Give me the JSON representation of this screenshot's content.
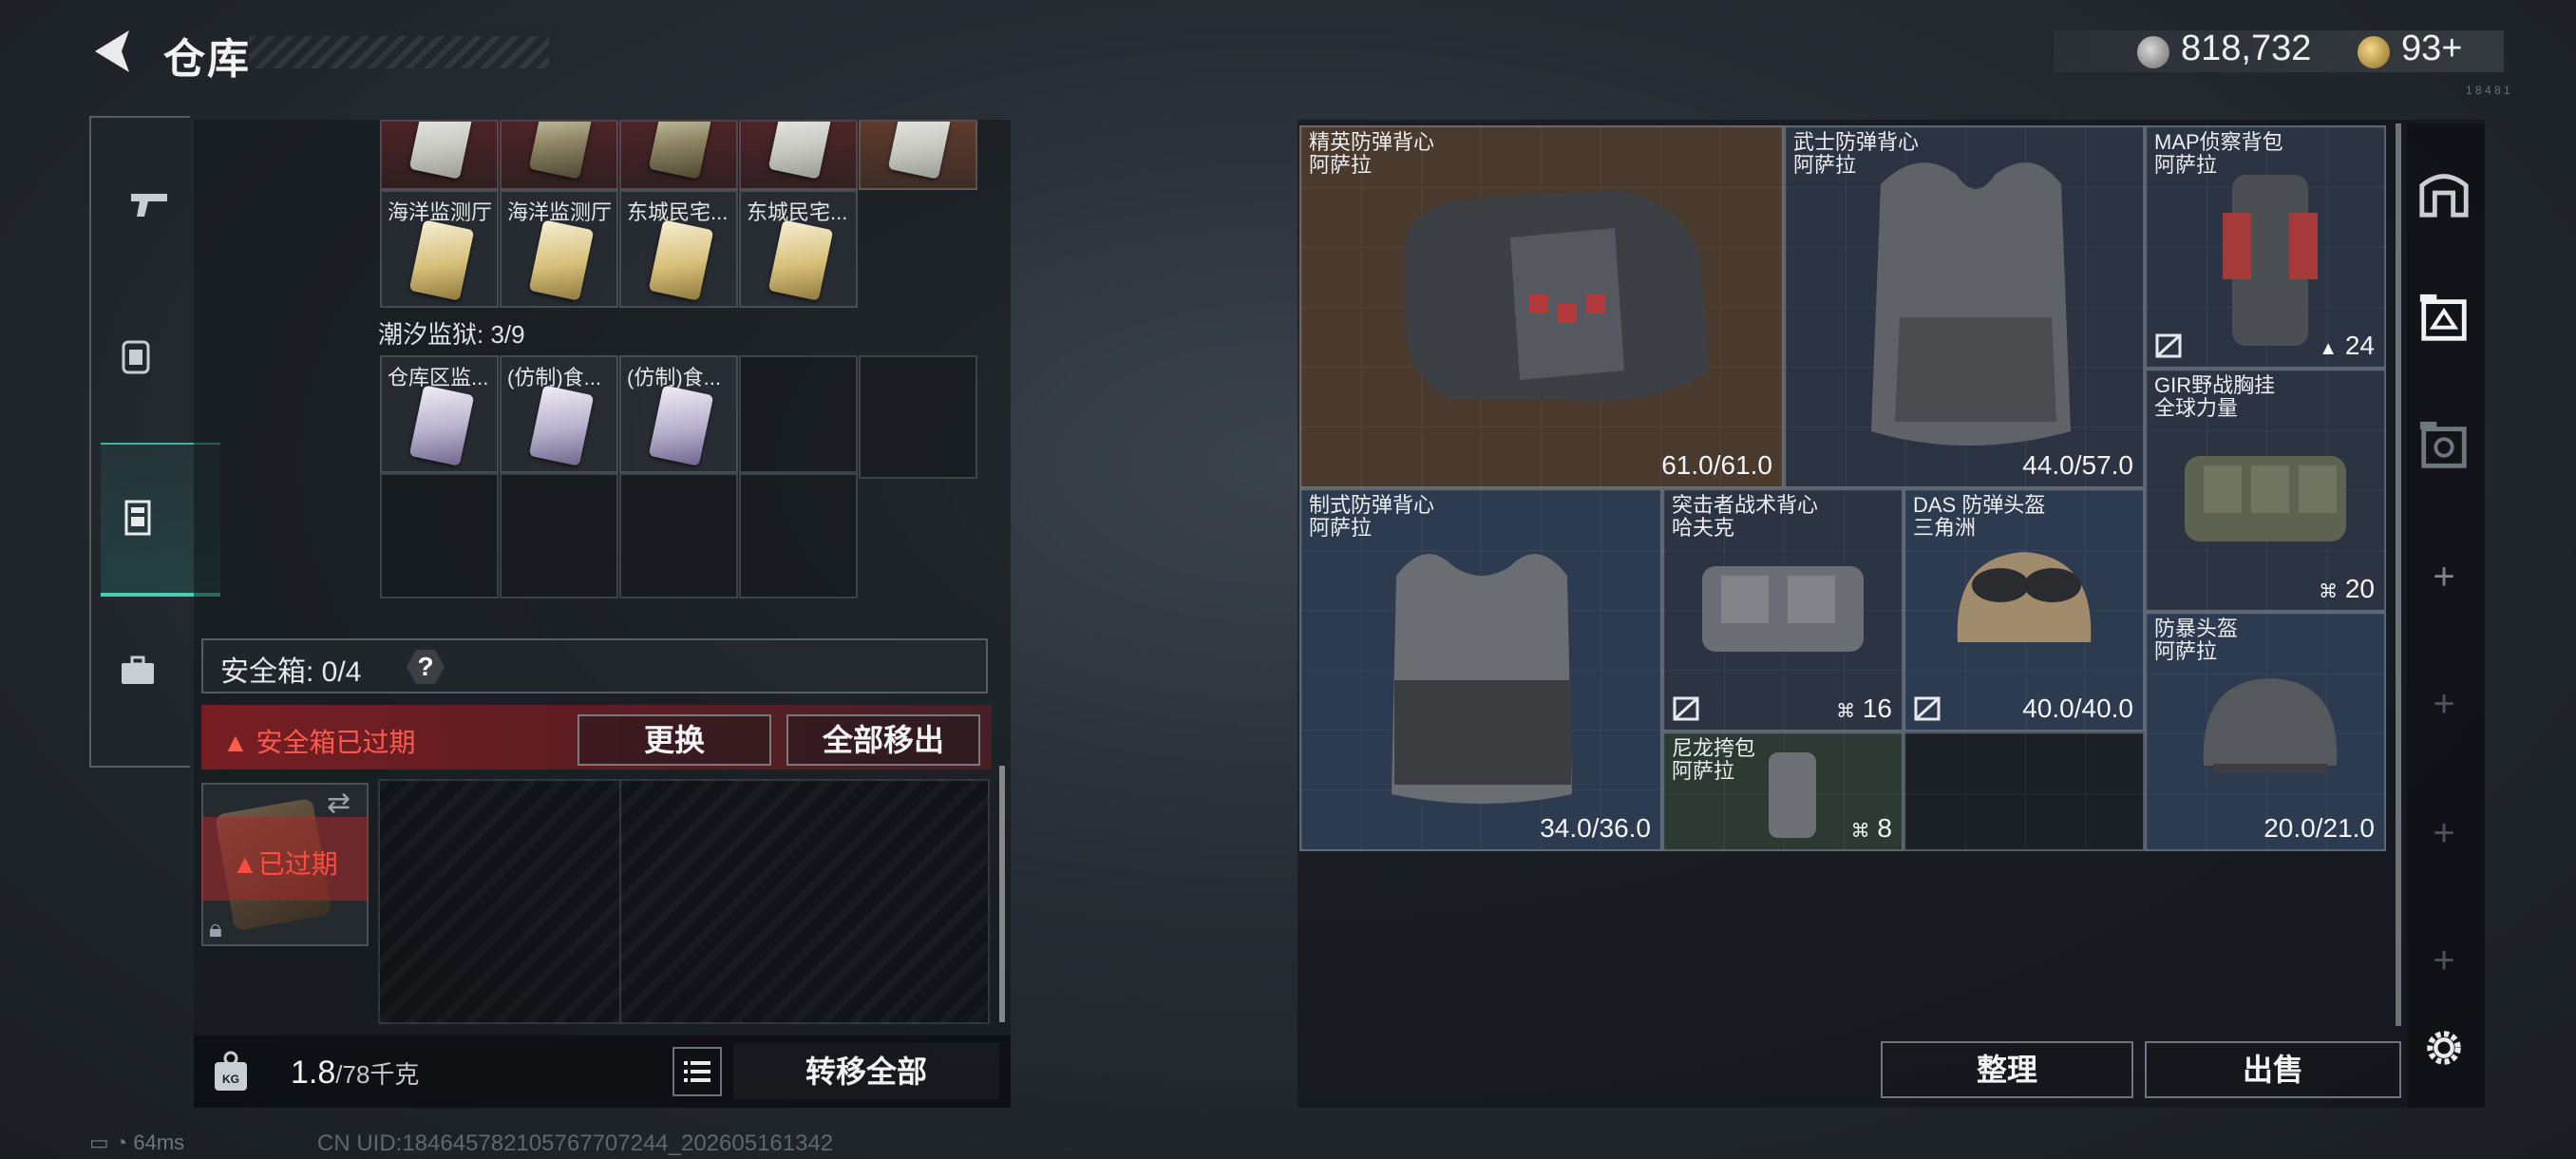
{
  "header": {
    "title": "仓库",
    "money": "818,732",
    "gold": "93+",
    "money_tiny": "1 8 4 8 1"
  },
  "left_tabs": [
    {
      "name": "weapons",
      "icon": "pistol-icon"
    },
    {
      "name": "equipment",
      "icon": "backpack-badge-icon"
    },
    {
      "name": "storage",
      "icon": "locker-icon",
      "active": true
    },
    {
      "name": "briefcase",
      "icon": "briefcase-icon"
    }
  ],
  "keycards": {
    "top_row": [
      "",
      "",
      "",
      "",
      ""
    ],
    "row2": [
      "海洋监测厅",
      "海洋监测厅",
      "东城民宅...",
      "东城民宅..."
    ],
    "prison_label": "潮汐监狱: 3/9",
    "prison_row": [
      "仓库区监...",
      "(仿制)食...",
      "(仿制)食..."
    ]
  },
  "safebox": {
    "label": "安全箱: 0/4",
    "help": "?",
    "expired_notice": "安全箱已过期",
    "replace_button": "更换",
    "move_all_button": "全部移出",
    "item_status": "已过期"
  },
  "footer_left": {
    "weight_value": "1.8",
    "weight_capacity": "/78千克",
    "transfer_button": "转移全部",
    "weight_icon_text": "KG"
  },
  "status": {
    "ping": "64ms",
    "uid": "CN UID:1846457821057677072​44_202605161342"
  },
  "equipment": [
    {
      "name": "精英防弹背心",
      "maker": "阿萨拉",
      "value": "61.0/61.0",
      "bg": "#4a3a2d"
    },
    {
      "name": "武士防弹背心",
      "maker": "阿萨拉",
      "value": "44.0/57.0",
      "bg": "#2c3443"
    },
    {
      "name": "MAP侦察背包",
      "maker": "阿萨拉",
      "value": "24",
      "bg": "#2c3443"
    },
    {
      "name": "GIR野战胸挂",
      "maker": "全球力量",
      "value": "20",
      "bg": "#2c3443"
    },
    {
      "name": "制式防弹背心",
      "maker": "阿萨拉",
      "value": "34.0/36.0",
      "bg": "#2c3b4f"
    },
    {
      "name": "突击者战术背心",
      "maker": "哈夫克",
      "value": "16",
      "bg": "#2c3443"
    },
    {
      "name": "DAS 防弹头盔",
      "maker": "三角洲",
      "value": "40.0/40.0",
      "bg": "#2c3b4f"
    },
    {
      "name": "防暴头盔",
      "maker": "阿萨拉",
      "value": "20.0/21.0",
      "bg": "#2c3b4f"
    },
    {
      "name": "尼龙挎包",
      "maker": "阿萨拉",
      "value": "8",
      "bg": "#2d3a33"
    }
  ],
  "right_footer": {
    "sort_button": "整理",
    "sell_button": "出售"
  },
  "right_tabs": [
    "vault-icon",
    "storage-iii-icon",
    "storage-iv-icon",
    "+",
    "+",
    "+",
    "+"
  ]
}
